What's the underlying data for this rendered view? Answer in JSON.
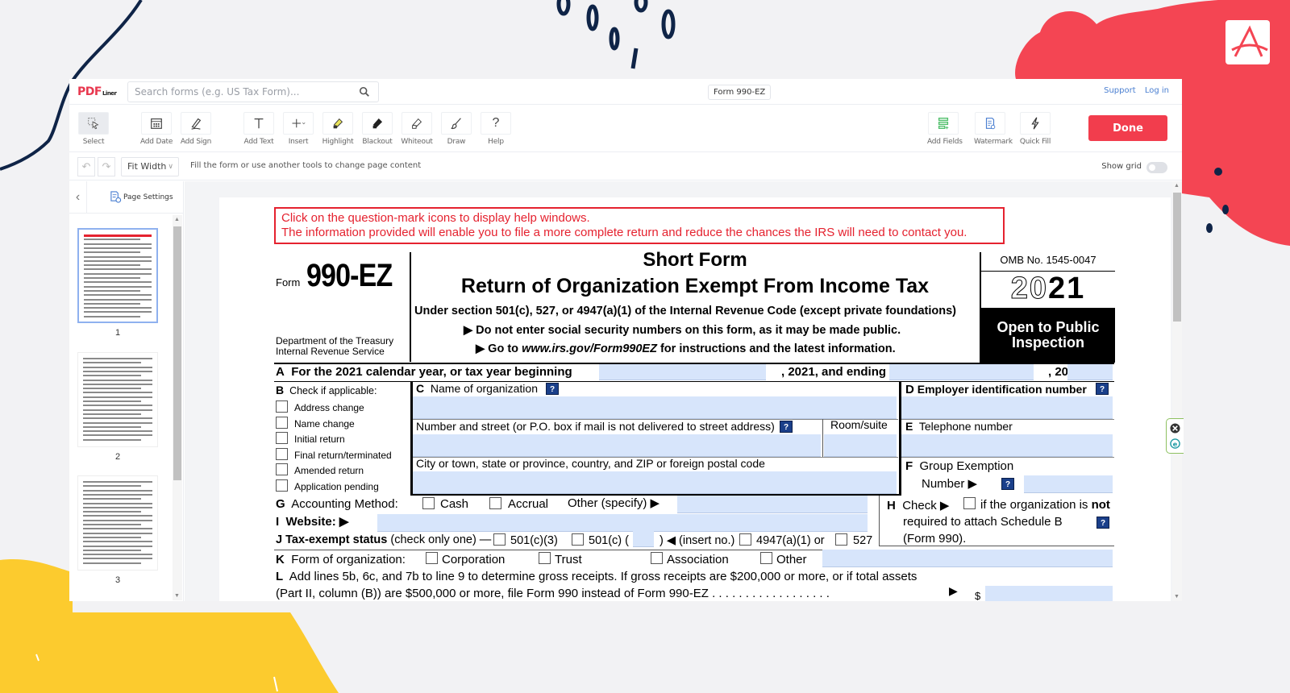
{
  "header": {
    "logo_main": "PDF",
    "logo_sub": "Liner",
    "search_placeholder": "Search forms (e.g. US Tax Form)...",
    "document_title": "Form 990-EZ",
    "links": [
      "Support",
      "Log in"
    ]
  },
  "toolbar": {
    "tools_left": [
      {
        "label": "Select",
        "icon": "select-cursor-icon",
        "active": true
      },
      {
        "label": "Add Date",
        "icon": "calendar-icon"
      },
      {
        "label": "Add Sign",
        "icon": "signature-pen-icon"
      },
      {
        "label": "Add Text",
        "icon": "text-t-icon"
      },
      {
        "label": "Insert",
        "icon": "plus-dropdown-icon"
      },
      {
        "label": "Highlight",
        "icon": "highlighter-icon"
      },
      {
        "label": "Blackout",
        "icon": "blackout-brush-icon"
      },
      {
        "label": "Whiteout",
        "icon": "whiteout-brush-icon"
      },
      {
        "label": "Draw",
        "icon": "draw-brush-icon"
      },
      {
        "label": "Help",
        "icon": "question-mark-icon"
      }
    ],
    "tools_right": [
      {
        "label": "Add Fields",
        "icon": "add-fields-icon"
      },
      {
        "label": "Watermark",
        "icon": "watermark-icon"
      },
      {
        "label": "Quick Fill",
        "icon": "lightning-icon"
      }
    ],
    "done_label": "Done"
  },
  "subbar": {
    "zoom_value": "Fit Width",
    "hint": "Fill the form or use another tools to change page content",
    "show_grid_label": "Show grid",
    "show_grid_on": false
  },
  "sidebar": {
    "page_settings_label": "Page Settings",
    "pages": [
      "1",
      "2",
      "3"
    ],
    "active_page": "1"
  },
  "form": {
    "notice_line1": "Click on the question-mark icons to display help windows.",
    "notice_line2": "The information provided will enable you to file a more complete return and reduce the chances the IRS will need to contact you.",
    "form_word": "Form",
    "form_number": "990-EZ",
    "dept_line1": "Department of the Treasury",
    "dept_line2": "Internal Revenue Service",
    "title_short": "Short Form",
    "title_main": "Return of Organization Exempt From Income Tax",
    "subtitle": "Under section 501(c), 527, or 4947(a)(1) of the Internal Revenue Code (except private foundations)",
    "instr1": "▶ Do not enter social security numbers on this form, as it may be made public.",
    "instr2_pre": "▶ Go to ",
    "instr2_url": "www.irs.gov/Form990EZ",
    "instr2_post": " for instructions and the latest information.",
    "omb": "OMB No. 1545-0047",
    "year_outline": "20",
    "year_bold": "21",
    "open_public": "Open to Public Inspection",
    "lineA_label": "A",
    "lineA_text": "For the 2021 calendar year, or tax year beginning",
    "lineA_mid": ", 2021, and ending",
    "lineA_end": ", 20",
    "lineB_label": "B",
    "lineB_text": "Check if applicable:",
    "b_options": [
      "Address change",
      "Name change",
      "Initial return",
      "Final return/terminated",
      "Amended return",
      "Application pending"
    ],
    "lineC_label": "C",
    "lineC_text": "Name of organization",
    "street_text": "Number and street (or P.O. box if mail is not delivered to street address)",
    "room_text": "Room/suite",
    "city_text": "City or town, state or province, country, and ZIP or foreign postal code",
    "lineD_label": "D",
    "lineD_text": "Employer identification number",
    "lineE_label": "E",
    "lineE_text": "Telephone number",
    "lineF_label": "F",
    "lineF_text1": "Group Exemption",
    "lineF_text2": "Number ▶",
    "lineG_label": "G",
    "lineG_text": "Accounting Method:",
    "g_options": [
      "Cash",
      "Accrual"
    ],
    "g_other": "Other (specify) ▶",
    "lineH_label": "H",
    "lineH_text1": "Check ▶",
    "lineH_text2": "if the organization is",
    "lineH_not": "not",
    "lineH_text3": "required to attach Schedule B",
    "lineH_text4": "(Form 990).",
    "lineI_label": "I",
    "lineI_text": "Website: ▶",
    "lineJ_label": "J",
    "lineJ_bold": "Tax-exempt status",
    "lineJ_text": "(check only one) —",
    "j_opt1": "501(c)(3)",
    "j_opt2": "501(c) (",
    "j_opt2_end": ") ◀ (insert no.)",
    "j_opt3": "4947(a)(1) or",
    "j_opt4": "527",
    "lineK_label": "K",
    "lineK_text": "Form of organization:",
    "k_options": [
      "Corporation",
      "Trust",
      "Association",
      "Other"
    ],
    "lineL_label": "L",
    "lineL_text1": "Add lines 5b, 6c, and 7b to line 9 to determine gross receipts. If gross receipts are $200,000 or more, or if total assets",
    "lineL_text2": "(Part II, column (B)) are $500,000 or more, file Form 990 instead of Form 990-EZ",
    "lineL_dots": ". . . . . . . . . . . . . . . . . .",
    "lineL_arrow": "▶",
    "lineL_dollar": "$",
    "help_glyph": "?"
  }
}
